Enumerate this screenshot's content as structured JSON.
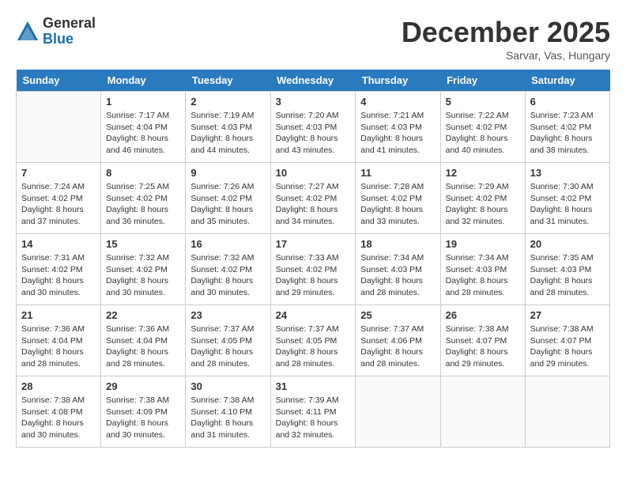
{
  "logo": {
    "general": "General",
    "blue": "Blue"
  },
  "header": {
    "month": "December 2025",
    "location": "Sarvar, Vas, Hungary"
  },
  "days_of_week": [
    "Sunday",
    "Monday",
    "Tuesday",
    "Wednesday",
    "Thursday",
    "Friday",
    "Saturday"
  ],
  "weeks": [
    [
      {
        "day": "",
        "info": ""
      },
      {
        "day": "1",
        "info": "Sunrise: 7:17 AM\nSunset: 4:04 PM\nDaylight: 8 hours\nand 46 minutes."
      },
      {
        "day": "2",
        "info": "Sunrise: 7:19 AM\nSunset: 4:03 PM\nDaylight: 8 hours\nand 44 minutes."
      },
      {
        "day": "3",
        "info": "Sunrise: 7:20 AM\nSunset: 4:03 PM\nDaylight: 8 hours\nand 43 minutes."
      },
      {
        "day": "4",
        "info": "Sunrise: 7:21 AM\nSunset: 4:03 PM\nDaylight: 8 hours\nand 41 minutes."
      },
      {
        "day": "5",
        "info": "Sunrise: 7:22 AM\nSunset: 4:02 PM\nDaylight: 8 hours\nand 40 minutes."
      },
      {
        "day": "6",
        "info": "Sunrise: 7:23 AM\nSunset: 4:02 PM\nDaylight: 8 hours\nand 38 minutes."
      }
    ],
    [
      {
        "day": "7",
        "info": "Sunrise: 7:24 AM\nSunset: 4:02 PM\nDaylight: 8 hours\nand 37 minutes."
      },
      {
        "day": "8",
        "info": "Sunrise: 7:25 AM\nSunset: 4:02 PM\nDaylight: 8 hours\nand 36 minutes."
      },
      {
        "day": "9",
        "info": "Sunrise: 7:26 AM\nSunset: 4:02 PM\nDaylight: 8 hours\nand 35 minutes."
      },
      {
        "day": "10",
        "info": "Sunrise: 7:27 AM\nSunset: 4:02 PM\nDaylight: 8 hours\nand 34 minutes."
      },
      {
        "day": "11",
        "info": "Sunrise: 7:28 AM\nSunset: 4:02 PM\nDaylight: 8 hours\nand 33 minutes."
      },
      {
        "day": "12",
        "info": "Sunrise: 7:29 AM\nSunset: 4:02 PM\nDaylight: 8 hours\nand 32 minutes."
      },
      {
        "day": "13",
        "info": "Sunrise: 7:30 AM\nSunset: 4:02 PM\nDaylight: 8 hours\nand 31 minutes."
      }
    ],
    [
      {
        "day": "14",
        "info": "Sunrise: 7:31 AM\nSunset: 4:02 PM\nDaylight: 8 hours\nand 30 minutes."
      },
      {
        "day": "15",
        "info": "Sunrise: 7:32 AM\nSunset: 4:02 PM\nDaylight: 8 hours\nand 30 minutes."
      },
      {
        "day": "16",
        "info": "Sunrise: 7:32 AM\nSunset: 4:02 PM\nDaylight: 8 hours\nand 30 minutes."
      },
      {
        "day": "17",
        "info": "Sunrise: 7:33 AM\nSunset: 4:02 PM\nDaylight: 8 hours\nand 29 minutes."
      },
      {
        "day": "18",
        "info": "Sunrise: 7:34 AM\nSunset: 4:03 PM\nDaylight: 8 hours\nand 28 minutes."
      },
      {
        "day": "19",
        "info": "Sunrise: 7:34 AM\nSunset: 4:03 PM\nDaylight: 8 hours\nand 28 minutes."
      },
      {
        "day": "20",
        "info": "Sunrise: 7:35 AM\nSunset: 4:03 PM\nDaylight: 8 hours\nand 28 minutes."
      }
    ],
    [
      {
        "day": "21",
        "info": "Sunrise: 7:36 AM\nSunset: 4:04 PM\nDaylight: 8 hours\nand 28 minutes."
      },
      {
        "day": "22",
        "info": "Sunrise: 7:36 AM\nSunset: 4:04 PM\nDaylight: 8 hours\nand 28 minutes."
      },
      {
        "day": "23",
        "info": "Sunrise: 7:37 AM\nSunset: 4:05 PM\nDaylight: 8 hours\nand 28 minutes."
      },
      {
        "day": "24",
        "info": "Sunrise: 7:37 AM\nSunset: 4:05 PM\nDaylight: 8 hours\nand 28 minutes."
      },
      {
        "day": "25",
        "info": "Sunrise: 7:37 AM\nSunset: 4:06 PM\nDaylight: 8 hours\nand 28 minutes."
      },
      {
        "day": "26",
        "info": "Sunrise: 7:38 AM\nSunset: 4:07 PM\nDaylight: 8 hours\nand 29 minutes."
      },
      {
        "day": "27",
        "info": "Sunrise: 7:38 AM\nSunset: 4:07 PM\nDaylight: 8 hours\nand 29 minutes."
      }
    ],
    [
      {
        "day": "28",
        "info": "Sunrise: 7:38 AM\nSunset: 4:08 PM\nDaylight: 8 hours\nand 30 minutes."
      },
      {
        "day": "29",
        "info": "Sunrise: 7:38 AM\nSunset: 4:09 PM\nDaylight: 8 hours\nand 30 minutes."
      },
      {
        "day": "30",
        "info": "Sunrise: 7:38 AM\nSunset: 4:10 PM\nDaylight: 8 hours\nand 31 minutes."
      },
      {
        "day": "31",
        "info": "Sunrise: 7:39 AM\nSunset: 4:11 PM\nDaylight: 8 hours\nand 32 minutes."
      },
      {
        "day": "",
        "info": ""
      },
      {
        "day": "",
        "info": ""
      },
      {
        "day": "",
        "info": ""
      }
    ]
  ]
}
